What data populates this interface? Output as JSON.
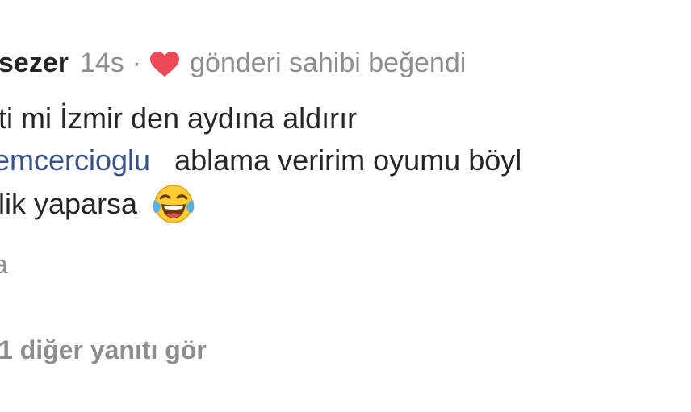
{
  "comment": {
    "username": "sezer",
    "time": "14s",
    "separator": "·",
    "liked_text": "gönderi sahibi beğendi",
    "line1": "ti mi İzmir den aydına aldırır",
    "mention": "emcercioglu",
    "line2_rest": "ablama veririm oyumu böyl",
    "line3": "lik yaparsa",
    "emoji": "laughing-with-tears-emoji",
    "reply_label": "a",
    "heart_color": "#ed4956"
  },
  "replies": {
    "more_label": "1 diğer yanıtı gör"
  }
}
